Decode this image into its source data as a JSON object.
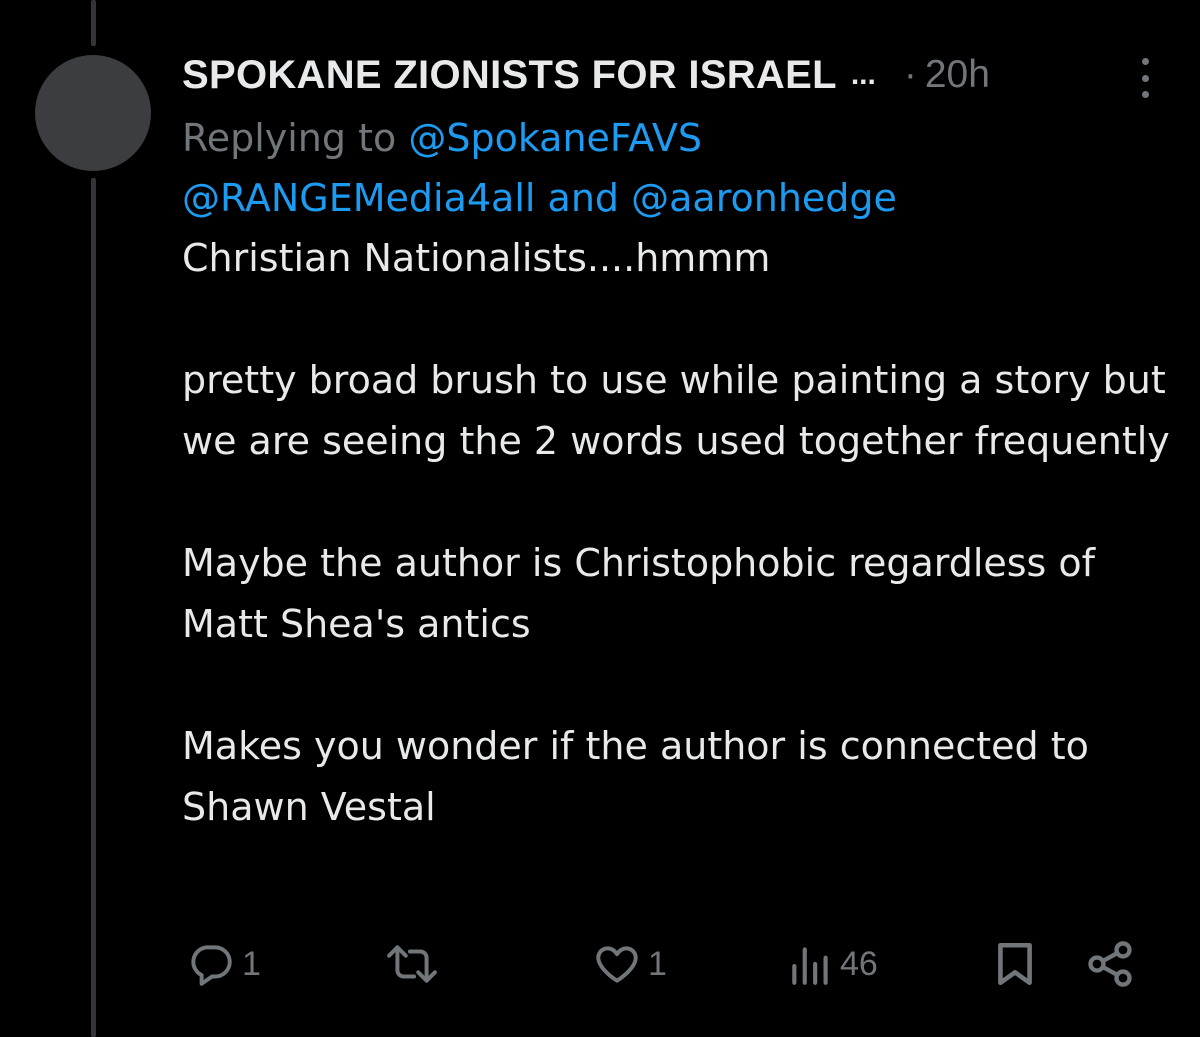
{
  "tweet": {
    "display_name": "SPOKANE ZIONISTS FOR ISRAEL",
    "name_truncation": "...",
    "separator": "·",
    "timestamp": "20h",
    "replying_prefix": "Replying to",
    "mentions": [
      "@SpokaneFAVS",
      "@RANGEMedia4all",
      "@aaronhedge"
    ],
    "mentions_joiner": "and",
    "paragraphs": [
      "Christian Nationalists....hmmm",
      "pretty broad brush to use while painting a story but we are seeing the 2 words used together frequently",
      "Maybe the author is Christophobic regardless of Matt Shea's antics",
      "Makes you wonder if the author is connected to Shawn Vestal"
    ]
  },
  "actions": {
    "replies": "1",
    "retweets": "",
    "likes": "1",
    "views": "46"
  },
  "icons": {
    "reply": "reply-bubble-icon",
    "retweet": "retweet-icon",
    "like": "heart-icon",
    "views": "bar-chart-icon",
    "bookmark": "bookmark-icon",
    "share": "share-icon",
    "more": "more-options-icon"
  },
  "colors": {
    "background": "#000000",
    "text": "#e7e9ea",
    "muted": "#71767b",
    "link": "#1d9bf0",
    "avatar": "#3c3d40",
    "thread_line": "#333639"
  }
}
